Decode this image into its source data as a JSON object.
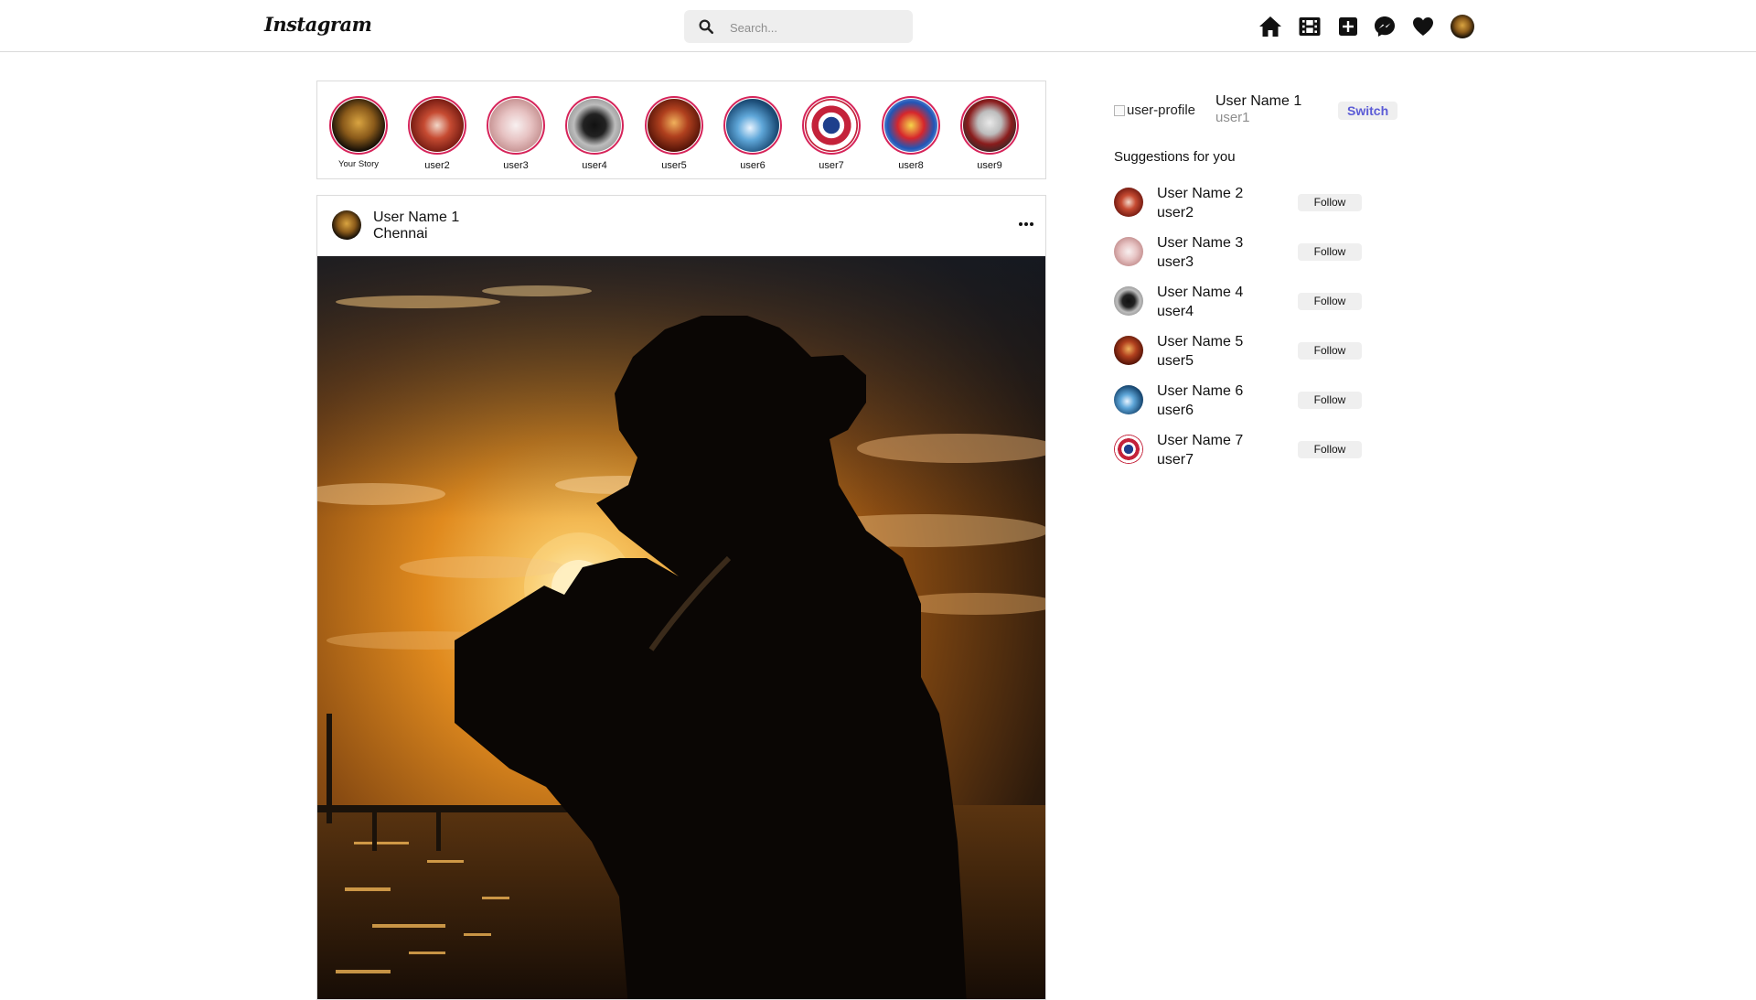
{
  "nav": {
    "logo": "Instagram",
    "search_placeholder": "Search...",
    "icons": [
      "home-icon",
      "reels-icon",
      "create-icon",
      "messenger-icon",
      "heart-icon",
      "profile-avatar"
    ]
  },
  "stories": [
    {
      "label": "Your Story"
    },
    {
      "label": "user2"
    },
    {
      "label": "user3"
    },
    {
      "label": "user4"
    },
    {
      "label": "user5"
    },
    {
      "label": "user6"
    },
    {
      "label": "user7"
    },
    {
      "label": "user8"
    },
    {
      "label": "user9"
    }
  ],
  "post": {
    "username": "User Name 1",
    "location": "Chennai"
  },
  "profile": {
    "image_alt": "user-profile",
    "name": "User Name 1",
    "username": "user1",
    "switch_label": "Switch"
  },
  "suggestions": {
    "title": "Suggestions for you",
    "items": [
      {
        "name": "User Name 2",
        "username": "user2",
        "button": "Follow"
      },
      {
        "name": "User Name 3",
        "username": "user3",
        "button": "Follow"
      },
      {
        "name": "User Name 4",
        "username": "user4",
        "button": "Follow"
      },
      {
        "name": "User Name 5",
        "username": "user5",
        "button": "Follow"
      },
      {
        "name": "User Name 6",
        "username": "user6",
        "button": "Follow"
      },
      {
        "name": "User Name 7",
        "username": "user7",
        "button": "Follow"
      }
    ]
  },
  "colors": {
    "story_ring": "#d6245a",
    "switch_text": "#5b5bd6",
    "border": "#dbdbdb"
  }
}
